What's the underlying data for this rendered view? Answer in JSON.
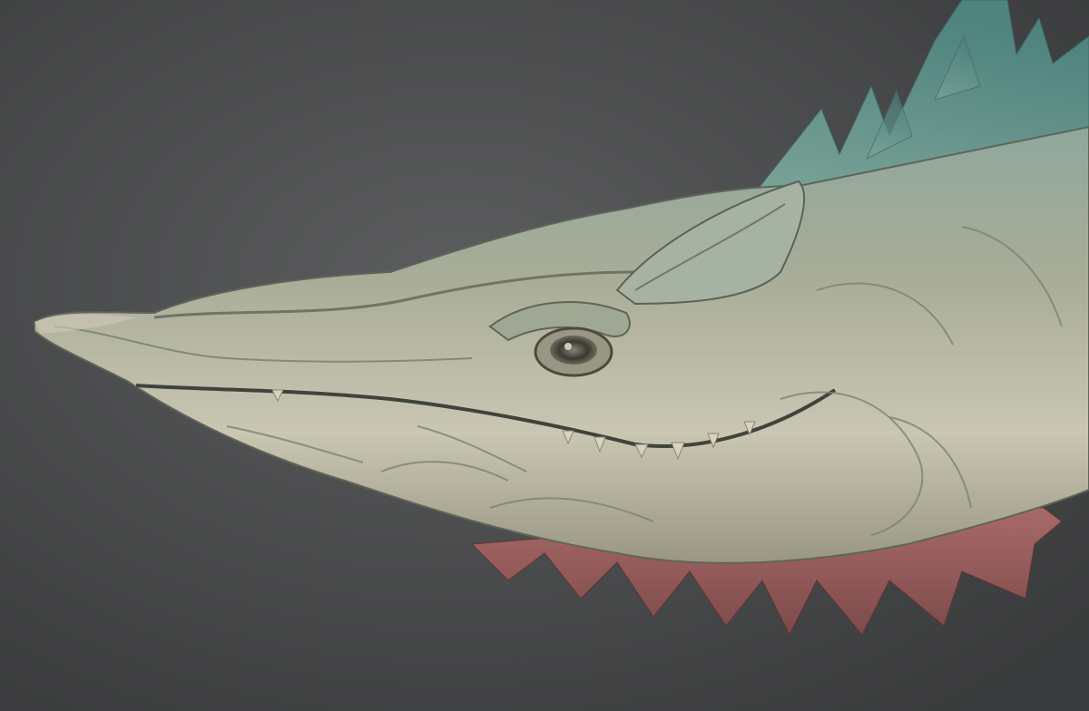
{
  "scene": {
    "subject": "creature-head-sculpt",
    "background": {
      "center": "#5c5d5e",
      "edge": "#3a3b3c"
    },
    "palette": {
      "skin_light": "#c9c6b2",
      "skin_mid": "#a9ad98",
      "skin_shadow": "#6f7566",
      "crest_teal": "#6fa39c",
      "crest_deep": "#4f837e",
      "fin_red": "#a86a68",
      "fin_dark": "#7d4a4a",
      "eye_dark": "#3b3a33",
      "tooth": "#d9d2bd"
    }
  }
}
